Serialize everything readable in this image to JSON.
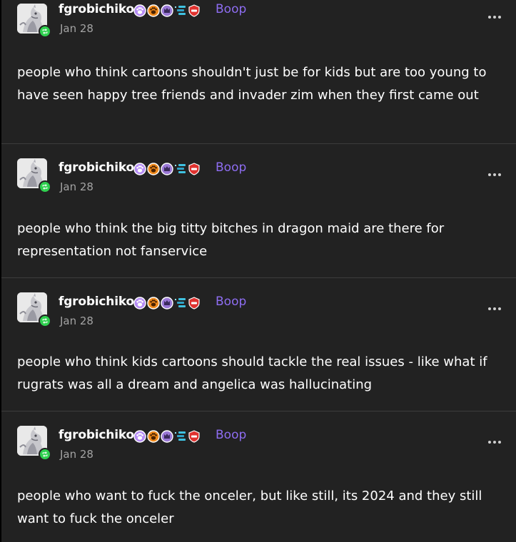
{
  "colors": {
    "background": "#000000",
    "card": "#222222",
    "username": "#ffffff",
    "boop": "#8e6df2",
    "date": "#a3a3a3",
    "reblog_green": "#2fd04f"
  },
  "posts": [
    {
      "username": "fgrobichiko",
      "boop_label": "Boop",
      "date": "Jan 28",
      "badge_icons": [
        "purple-paw-badge-icon",
        "orange-paw-badge-icon",
        "purple-paw-badge-icon",
        "blue-stack-badge-icon",
        "red-shield-badge-icon"
      ],
      "text": "people who think cartoons shouldn't just be for kids but are too young to have seen happy tree friends and invader zim when they first came out"
    },
    {
      "username": "fgrobichiko",
      "boop_label": "Boop",
      "date": "Jan 28",
      "badge_icons": [
        "purple-paw-badge-icon",
        "orange-paw-badge-icon",
        "purple-paw-badge-icon",
        "blue-stack-badge-icon",
        "red-shield-badge-icon"
      ],
      "text": "people who think the big titty bitches in dragon maid are there for representation not fanservice"
    },
    {
      "username": "fgrobichiko",
      "boop_label": "Boop",
      "date": "Jan 28",
      "badge_icons": [
        "purple-paw-badge-icon",
        "orange-paw-badge-icon",
        "purple-paw-badge-icon",
        "blue-stack-badge-icon",
        "red-shield-badge-icon"
      ],
      "text": "people who think kids cartoons should tackle the real issues - like what if rugrats was all a dream and angelica was hallucinating"
    },
    {
      "username": "fgrobichiko",
      "boop_label": "Boop",
      "date": "Jan 28",
      "badge_icons": [
        "purple-paw-badge-icon",
        "orange-paw-badge-icon",
        "purple-paw-badge-icon",
        "blue-stack-badge-icon",
        "red-shield-badge-icon"
      ],
      "text": "people who want to fuck the onceler, but like still, its 2024 and they still want to fuck the onceler"
    }
  ]
}
